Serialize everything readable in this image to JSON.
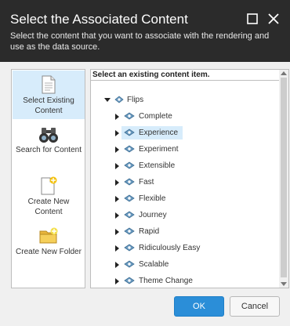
{
  "dialog": {
    "title": "Select the Associated Content",
    "subtitle": "Select the content that you want to associate with the rendering and use as the data source."
  },
  "sidebar": {
    "items": [
      {
        "label": "Select Existing Content",
        "icon": "document-icon",
        "selected": true
      },
      {
        "label": "Search for Content",
        "icon": "binoculars-icon",
        "selected": false
      },
      {
        "label": "Create New Content",
        "icon": "new-document-icon",
        "selected": false
      },
      {
        "label": "Create New Folder",
        "icon": "new-folder-icon",
        "selected": false
      }
    ]
  },
  "tree": {
    "caption": "Select an existing content item.",
    "root": {
      "label": "Flips",
      "expanded": true
    },
    "children": [
      {
        "label": "Complete",
        "selected": false
      },
      {
        "label": "Experience",
        "selected": true
      },
      {
        "label": "Experiment",
        "selected": false
      },
      {
        "label": "Extensible",
        "selected": false
      },
      {
        "label": "Fast",
        "selected": false
      },
      {
        "label": "Flexible",
        "selected": false
      },
      {
        "label": "Journey",
        "selected": false
      },
      {
        "label": "Rapid",
        "selected": false
      },
      {
        "label": "Ridiculously Easy",
        "selected": false
      },
      {
        "label": "Scalable",
        "selected": false
      },
      {
        "label": "Theme Change",
        "selected": false
      }
    ]
  },
  "footer": {
    "ok_label": "OK",
    "cancel_label": "Cancel"
  },
  "colors": {
    "header_bg": "#2b2b2b",
    "accent": "#2b8ed8",
    "selection": "#d7ecfb"
  }
}
